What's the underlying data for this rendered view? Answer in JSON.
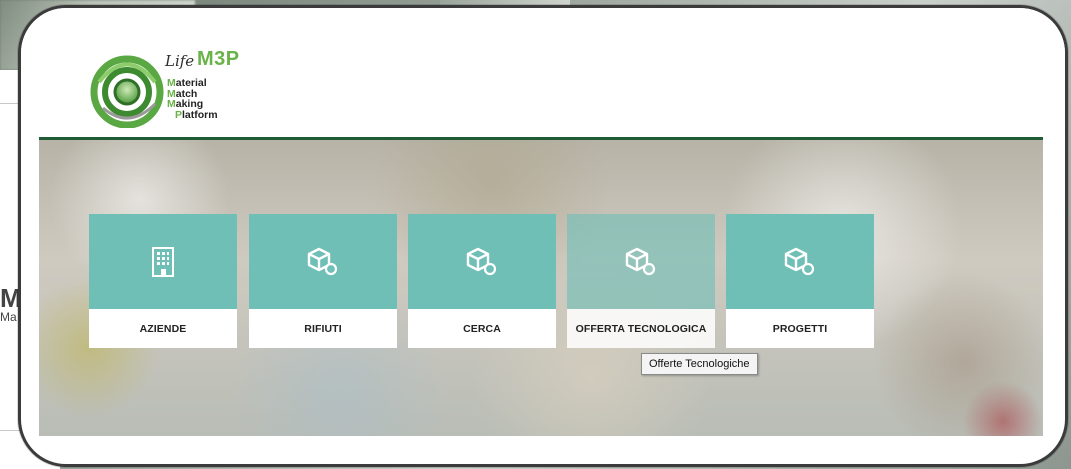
{
  "logo": {
    "life": "Life",
    "m3p": "M3P",
    "lines": [
      {
        "cap": "M",
        "rest": "aterial"
      },
      {
        "cap": "M",
        "rest": "atch"
      },
      {
        "cap": "M",
        "rest": "aking"
      },
      {
        "cap": "P",
        "rest": "latform"
      }
    ]
  },
  "background": {
    "ghost_logo_big": "M",
    "ghost_logo_small": "Ma"
  },
  "tiles": [
    {
      "label": "AZIENDE",
      "icon": "building-icon"
    },
    {
      "label": "RIFIUTI",
      "icon": "cube-search-icon"
    },
    {
      "label": "CERCA",
      "icon": "cube-search-icon"
    },
    {
      "label": "OFFERTA TECNOLOGICA",
      "icon": "cube-search-icon",
      "state": "hover"
    },
    {
      "label": "PROGETTI",
      "icon": "cube-search-icon"
    }
  ],
  "tooltip": "Offerte Tecnologiche",
  "colors": {
    "tile": "#6fbfb6",
    "rule": "#1f5b35",
    "brand_green": "#6ab24a"
  }
}
